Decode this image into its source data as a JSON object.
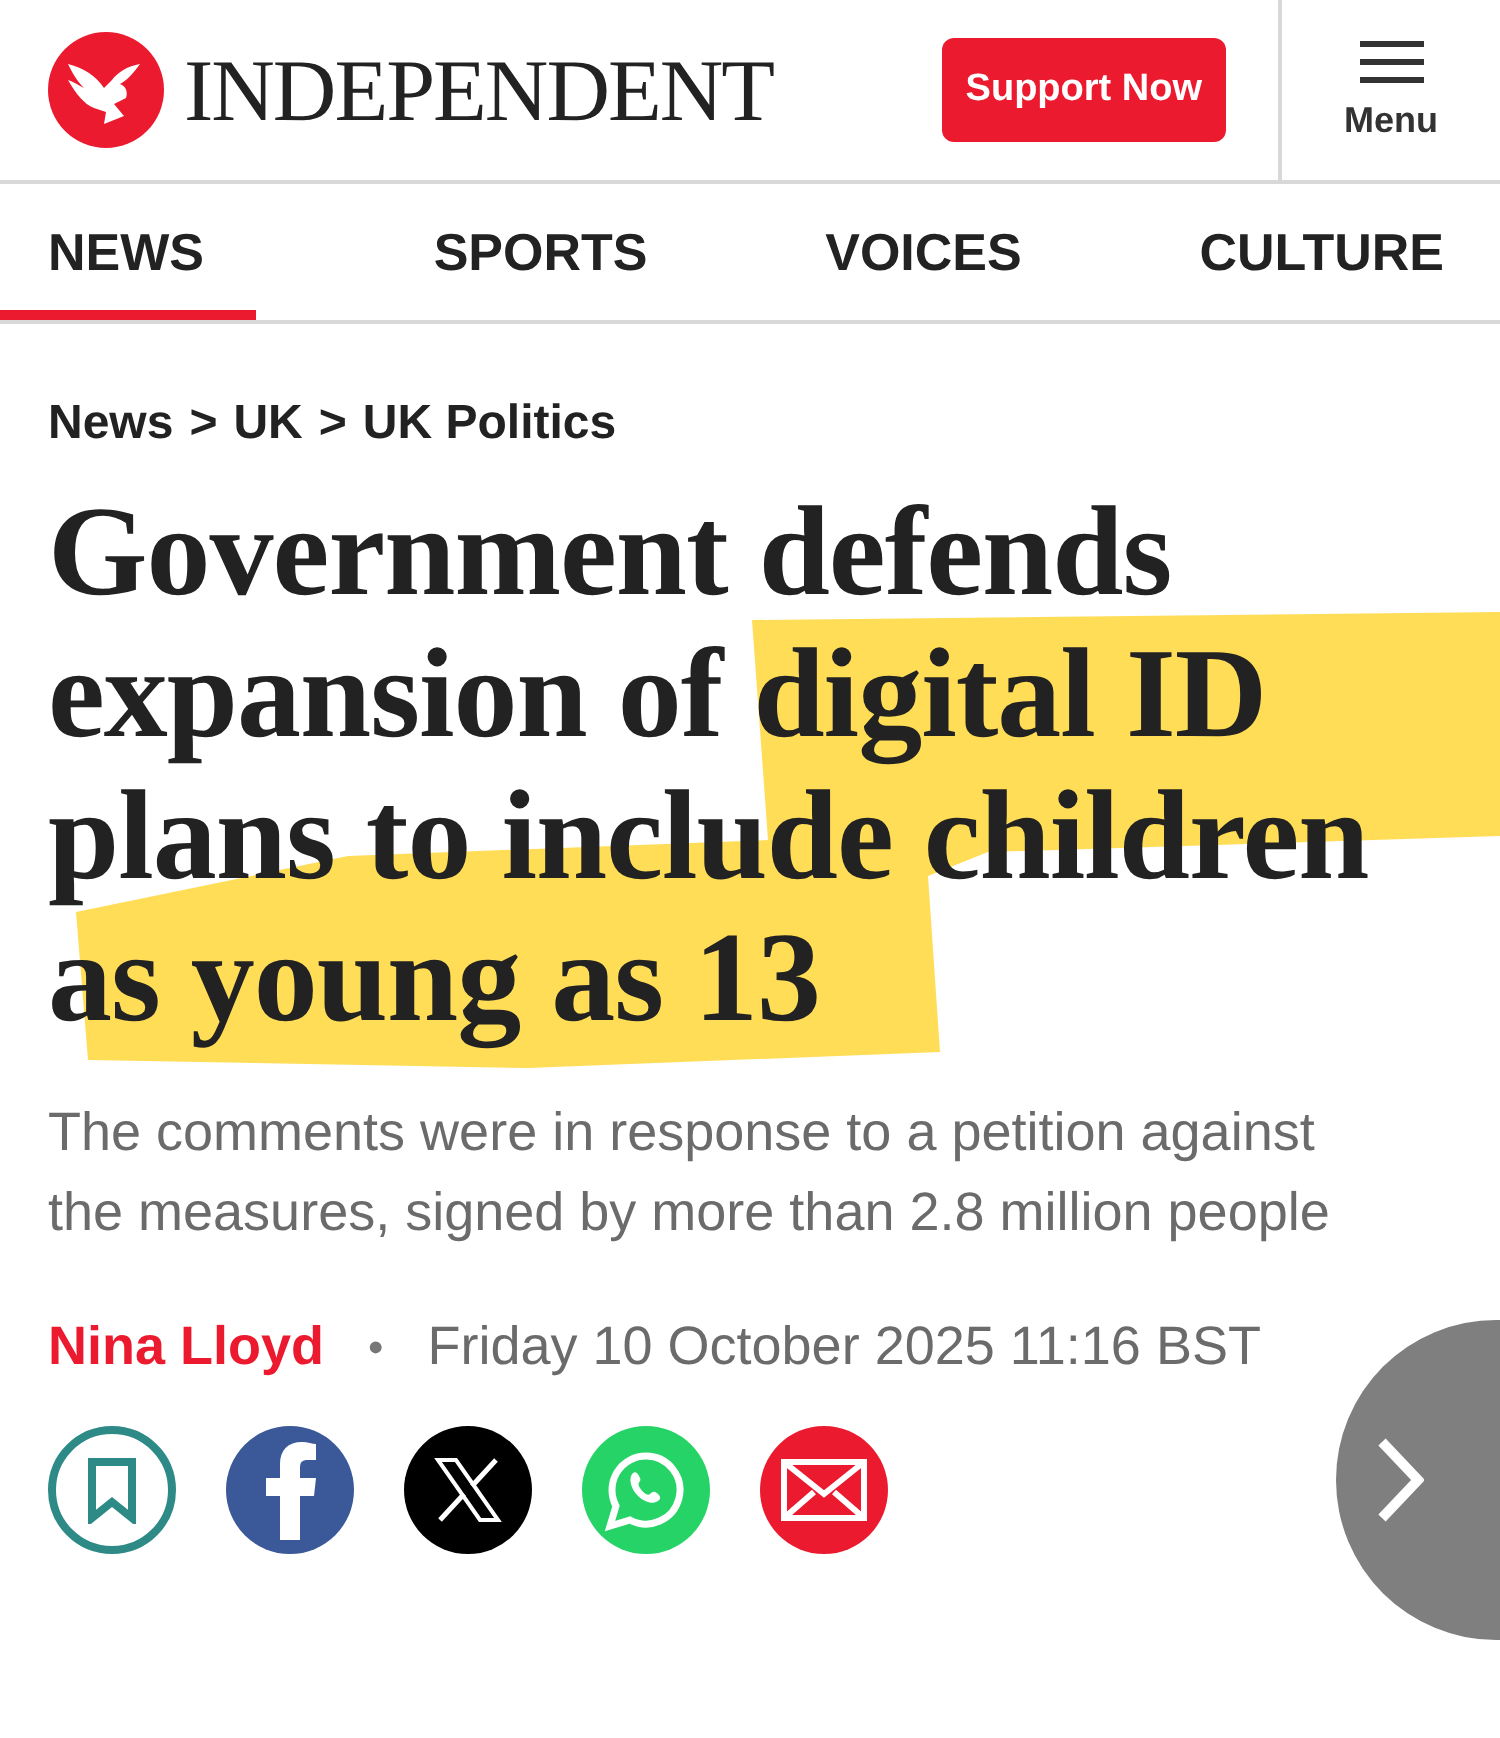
{
  "header": {
    "logo_text": "INDEPENDENT",
    "support_button": "Support Now",
    "menu_label": "Menu"
  },
  "tabs": [
    {
      "label": "NEWS",
      "selected": true
    },
    {
      "label": "SPORTS",
      "selected": false
    },
    {
      "label": "VOICES",
      "selected": false
    },
    {
      "label": "CULTURE",
      "selected": false
    }
  ],
  "breadcrumb": [
    {
      "label": "News"
    },
    {
      "label": "UK"
    },
    {
      "label": "UK Politics"
    }
  ],
  "breadcrumb_separator": ">",
  "article": {
    "headline": "Government defends expansion of digital ID plans to include children as young as 13",
    "highlighted": true,
    "standfirst": "The comments were in response to a petition against the measures, signed by more than 2.8 million people",
    "author": "Nina Lloyd",
    "byline_separator": "•",
    "date": "Friday 10 October 2025 11:16 BST"
  },
  "share_buttons": [
    {
      "kind": "bookmark"
    },
    {
      "kind": "facebook"
    },
    {
      "kind": "x"
    },
    {
      "kind": "whatsapp"
    },
    {
      "kind": "email"
    }
  ]
}
